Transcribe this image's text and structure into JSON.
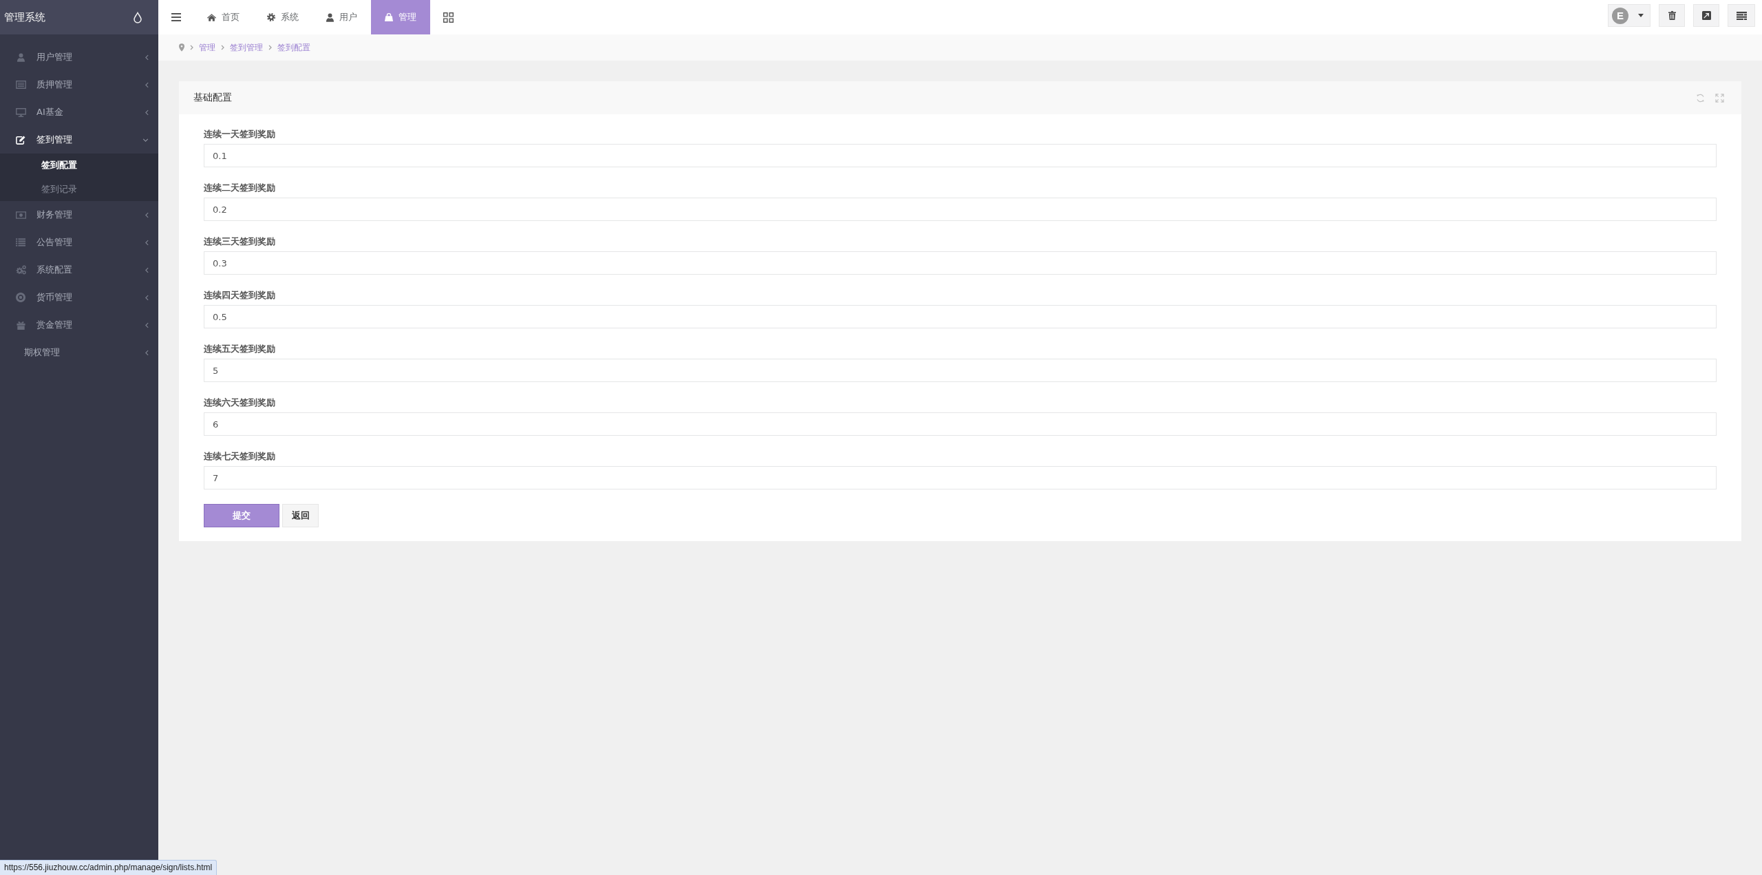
{
  "sidebar": {
    "brand": "管理系统",
    "menu": [
      {
        "label": "用户管理",
        "expanded": false
      },
      {
        "label": "质押管理",
        "expanded": false
      },
      {
        "label": "AI基金",
        "expanded": false
      },
      {
        "label": "签到管理",
        "expanded": true,
        "children": [
          {
            "label": "签到配置",
            "selected": true
          },
          {
            "label": "签到记录",
            "selected": false
          }
        ]
      },
      {
        "label": "财务管理",
        "expanded": false
      },
      {
        "label": "公告管理",
        "expanded": false
      },
      {
        "label": "系统配置",
        "expanded": false
      },
      {
        "label": "货币管理",
        "expanded": false
      },
      {
        "label": "赏金管理",
        "expanded": false
      },
      {
        "label": "期权管理",
        "expanded": false
      }
    ]
  },
  "tabs": [
    {
      "label": "首页",
      "selected": false
    },
    {
      "label": "系统",
      "selected": false
    },
    {
      "label": "用户",
      "selected": false
    },
    {
      "label": "管理",
      "selected": true
    }
  ],
  "user_menu": {
    "avatar_letter": "E"
  },
  "breadcrumb": [
    "管理",
    "签到管理",
    "签到配置"
  ],
  "panel": {
    "title": "基础配置",
    "fields": [
      {
        "label": "连续一天签到奖励",
        "value": "0.1"
      },
      {
        "label": "连续二天签到奖励",
        "value": "0.2"
      },
      {
        "label": "连续三天签到奖励",
        "value": "0.3"
      },
      {
        "label": "连续四天签到奖励",
        "value": "0.5"
      },
      {
        "label": "连续五天签到奖励",
        "value": "5"
      },
      {
        "label": "连续六天签到奖励",
        "value": "6"
      },
      {
        "label": "连续七天签到奖励",
        "value": "7"
      }
    ],
    "buttons": [
      {
        "label": "提交",
        "kind": "primary"
      },
      {
        "label": "返回",
        "kind": "default"
      }
    ]
  },
  "status_url": "https://556.jiuzhouw.cc/admin.php/manage/sign/lists.html"
}
